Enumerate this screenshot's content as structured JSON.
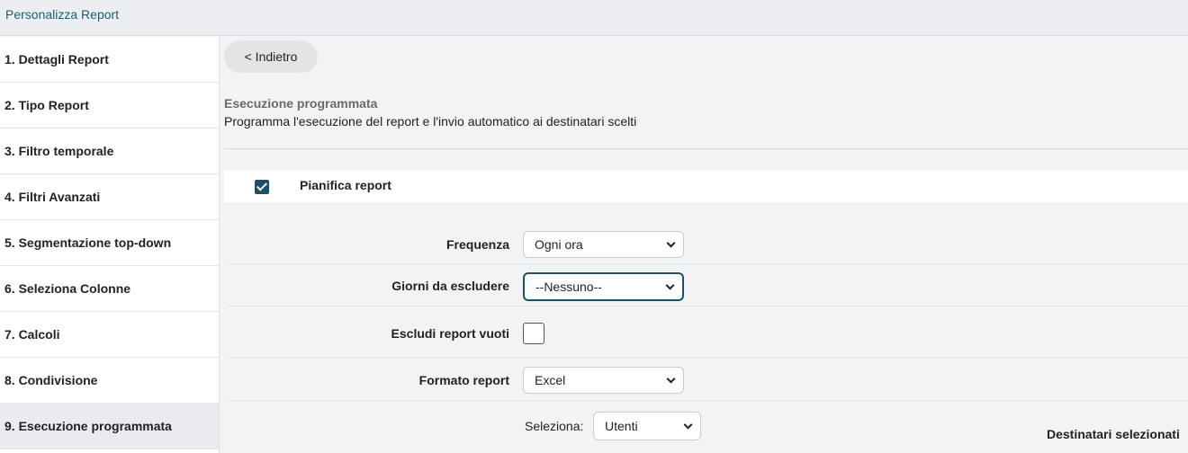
{
  "header": {
    "title": "Personalizza Report"
  },
  "sidebar": {
    "items": [
      {
        "label": "1. Dettagli Report"
      },
      {
        "label": "2. Tipo Report"
      },
      {
        "label": "3. Filtro temporale"
      },
      {
        "label": "4. Filtri Avanzati"
      },
      {
        "label": "5. Segmentazione top-down"
      },
      {
        "label": "6. Seleziona Colonne"
      },
      {
        "label": "7. Calcoli"
      },
      {
        "label": "8. Condivisione"
      },
      {
        "label": "9. Esecuzione programmata"
      }
    ]
  },
  "main": {
    "back_label": "< Indietro",
    "section_title": "Esecuzione programmata",
    "section_desc": "Programma l'esecuzione del report e l'invio automatico ai destinatari scelti",
    "plan_label": "Pianifica report",
    "plan_checked": true,
    "frequency": {
      "label": "Frequenza",
      "value": "Ogni ora"
    },
    "exclude_days": {
      "label": "Giorni da escludere",
      "value": "--Nessuno--"
    },
    "exclude_empty": {
      "label": "Escludi report vuoti",
      "checked": false
    },
    "format": {
      "label": "Formato report",
      "value": "Excel"
    },
    "select": {
      "label": "Seleziona:",
      "value": "Utenti"
    },
    "recipients_label": "Destinatari selezionati"
  }
}
